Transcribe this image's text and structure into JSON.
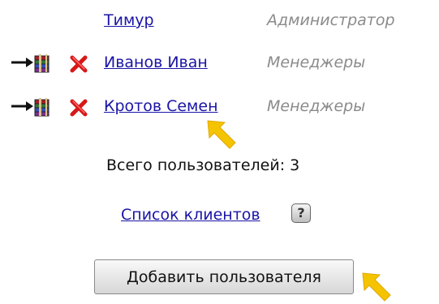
{
  "users": [
    {
      "name": "Тимур",
      "role": "Администратор",
      "show_actions": false
    },
    {
      "name": "Иванов Иван",
      "role": "Менеджеры",
      "show_actions": true
    },
    {
      "name": "Кротов Семен",
      "role": "Менеджеры",
      "show_actions": true
    }
  ],
  "summary": {
    "total_label": "Всего пользователей: 3"
  },
  "links": {
    "clients_label": "Список клиентов",
    "help_symbol": "?"
  },
  "actions": {
    "add_user_label": "Добавить пользователя"
  },
  "icons": {
    "archive_icon": "archive-icon",
    "delete_icon": "delete-icon",
    "pointer_icon": "yellow-arrow-pointer-icon"
  },
  "colors": {
    "link": "#1a14a6",
    "role_text": "#8b8b8b",
    "delete": "#d71818",
    "pointer": "#f5c400"
  }
}
